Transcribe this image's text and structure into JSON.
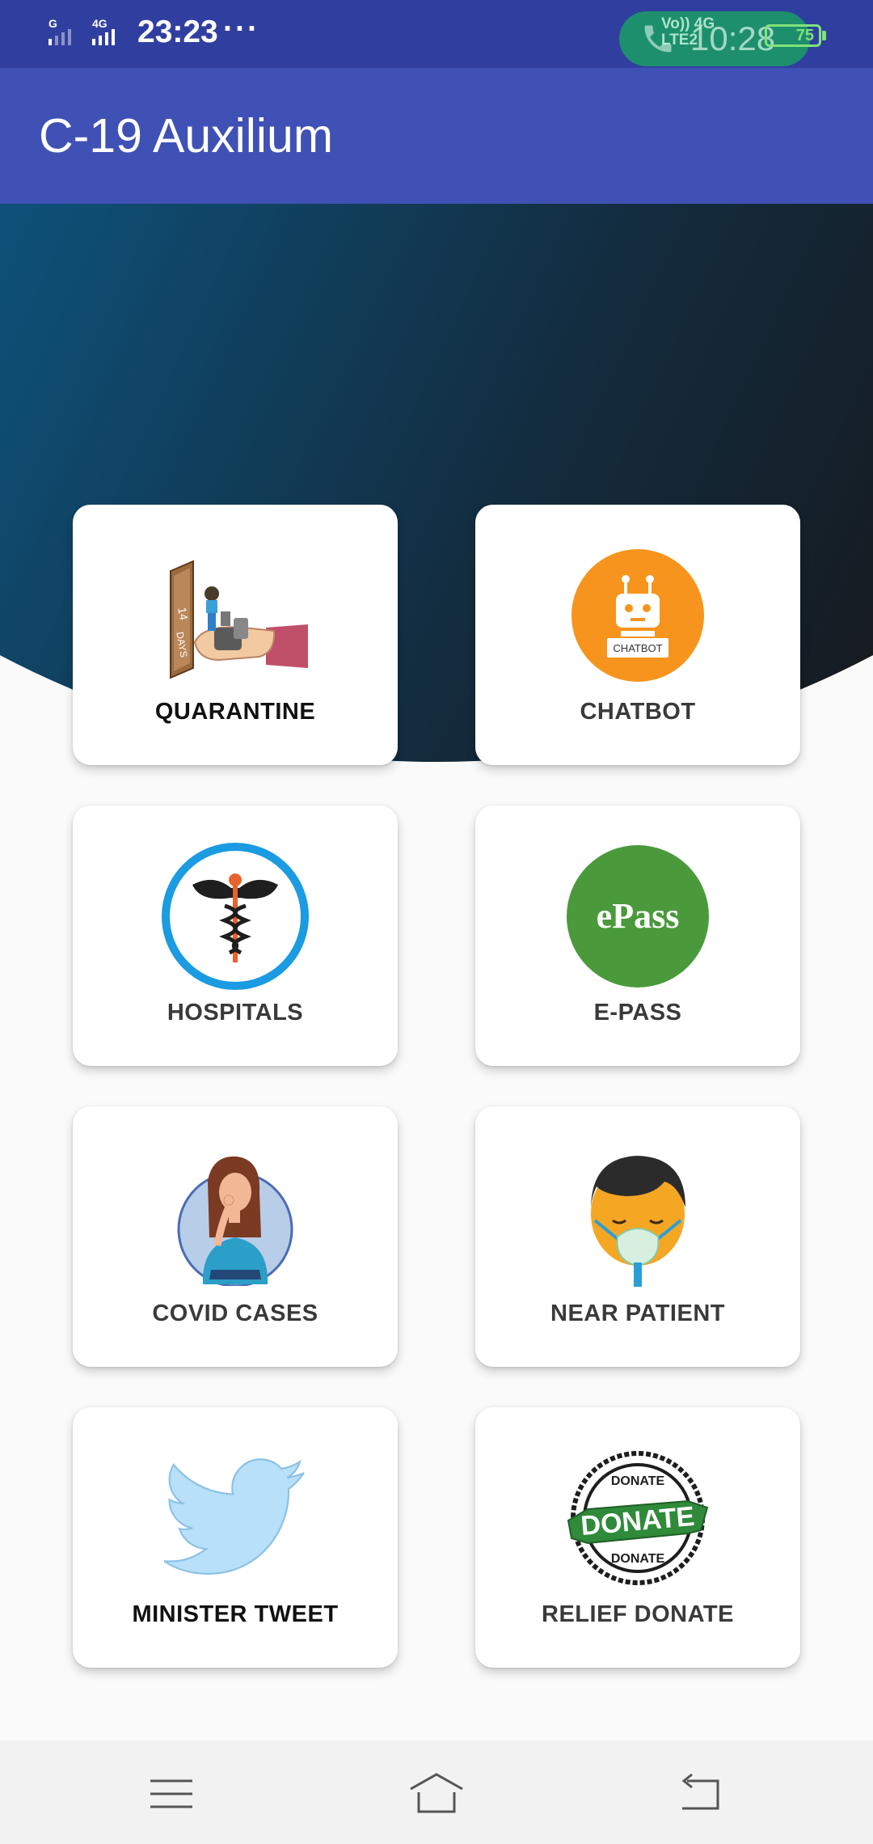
{
  "status_bar": {
    "signal_1": "G",
    "signal_2": "4G",
    "time": "23:23",
    "more": "···",
    "call_time": "10:28",
    "call_net_top": "Vo)) 4G",
    "call_net_bottom": "LTE2",
    "battery_level": "75"
  },
  "app_bar": {
    "title": "C-19 Auxilium"
  },
  "cards": [
    {
      "label": "QUARANTINE",
      "icon": "quarantine-icon"
    },
    {
      "label": "CHATBOT",
      "icon": "chatbot-icon",
      "icon_text": "CHATBOT"
    },
    {
      "label": "HOSPITALS",
      "icon": "hospital-caduceus-icon"
    },
    {
      "label": "E-PASS",
      "icon": "epass-icon",
      "icon_text": "ePass"
    },
    {
      "label": "COVID CASES",
      "icon": "covid-cases-icon"
    },
    {
      "label": "NEAR PATIENT",
      "icon": "patient-oxygen-mask-icon"
    },
    {
      "label": "MINISTER TWEET",
      "icon": "twitter-bird-icon"
    },
    {
      "label": "RELIEF DONATE",
      "icon": "donate-badge-icon",
      "icon_text": "DONATE"
    }
  ],
  "colors": {
    "status_bar": "#303f9f",
    "app_bar": "#3f51b5",
    "chatbot_orange": "#f7941d",
    "epass_green": "#4a9a3c",
    "hospital_blue": "#1a9be2",
    "twitter_blue": "#b8e0f8",
    "donate_green": "#2f8a3a"
  },
  "nav_bar": {
    "menu": "menu-icon",
    "home": "home-icon",
    "back": "back-icon"
  }
}
